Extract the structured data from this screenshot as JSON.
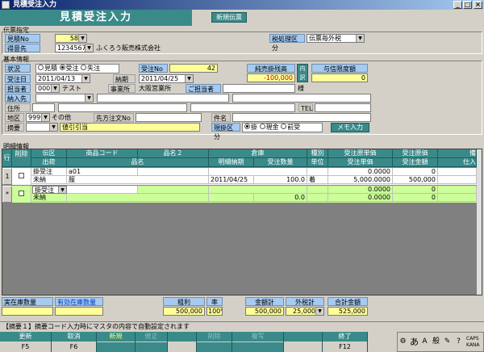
{
  "window": {
    "title": "見積受注入力"
  },
  "banner": {
    "title": "見積受注入力",
    "mode_badge": "新規伝票"
  },
  "denpyo": {
    "section": "伝票指定",
    "mitsumori_no_label": "見積No",
    "mitsumori_no_value": "58",
    "tokuisaki_label": "得意先",
    "tokuisaki_code": "1234567",
    "tokuisaki_name": "ふくろう販売株式会社",
    "zei_label": "税処理区分",
    "zei_value": "伝票毎外税"
  },
  "kihon": {
    "section": "基本情報",
    "jokyo_label": "状況",
    "jokyo_options": [
      "見積",
      "受注",
      "失注"
    ],
    "jokyo_selected": 1,
    "juchu_no_label": "受注No",
    "juchu_no_value": "42",
    "juchu_date_label": "受注日",
    "juchu_date_value": "2011/04/13",
    "noki_label": "納期",
    "noki_value": "2011/04/25",
    "tanto_label": "担当者",
    "tanto_code": "0001",
    "tanto_name": "テスト",
    "jigyosho_label": "事業所",
    "jigyosho_value": "大阪営業所",
    "gotanto_label": "ご担当者名",
    "gotanto_suffix": "様",
    "nonyu_label": "納入先",
    "jusho_label": "住所",
    "tel_label": "TEL",
    "chiku_label": "地区",
    "chiku_code": "9999",
    "chiku_name": "その他",
    "sakichumon_label": "先方注文No",
    "kenmei_label": "件名",
    "tekiyo_label": "摘要",
    "tekiyo_value": "値引引当",
    "genkake_label": "現掛区分",
    "genkake_options": [
      "掛",
      "現金",
      "前受"
    ],
    "genkake_selected": 0,
    "memo_button": "メモ入力",
    "junshiri_label": "純売掛残高",
    "junshiri_value": "-100,000",
    "naiyaku_button": "内訳",
    "yoshin_label": "与信限度額",
    "yoshin_value": "0"
  },
  "meisai": {
    "section": "明細情報",
    "headers_row1": [
      "行No",
      "削除",
      "伝区",
      "商品コード",
      "品名２",
      "倉庫",
      "",
      "種別",
      "受注原単価",
      "受注原価",
      "備"
    ],
    "headers_row2": [
      "",
      "",
      "出荷",
      "品名",
      "",
      "明細納期",
      "受注数量",
      "単位",
      "受注単価",
      "受注金額",
      "仕入"
    ],
    "rows": [
      {
        "no": "1",
        "denku": "掛受注",
        "shoka": "未納",
        "code": "a01",
        "name": "服",
        "noki": "2011/04/25",
        "qty": "100.0",
        "unit": "着",
        "gen_tanka": "0.0000",
        "gen_kin": "0",
        "tanka": "5,000.0000",
        "kingaku": "500,000"
      },
      {
        "no": "*",
        "denku": "掛受注",
        "shoka": "未納",
        "code": "",
        "name": "",
        "noki": "",
        "qty": "0.0",
        "unit": "",
        "gen_tanka": "0.0000",
        "gen_kin": "0",
        "tanka": "0.0000",
        "kingaku": "0"
      }
    ]
  },
  "summary": {
    "jitsuzaiko_label": "実在庫数量",
    "yuko_label": "有効在庫数量",
    "arari_label": "粗利",
    "arari_value": "500,000",
    "ritsu_label": "率",
    "ritsu_value": "100%",
    "kingaku_label": "金額計",
    "kingaku_value": "500,000",
    "sotozei_label": "外税計",
    "sotozei_value": "25,000",
    "gokei_label": "合計金額",
    "gokei_value": "525,000"
  },
  "message": "【摘要１】摘要コード入力時にマスタの内容で自動設定されます",
  "fkeys": [
    {
      "label": "更新",
      "key": "F5"
    },
    {
      "label": "取消",
      "key": "F6"
    },
    {
      "label": "新規",
      "key": ""
    },
    {
      "label": "修正",
      "key": ""
    },
    {
      "label": "削除",
      "key": ""
    },
    {
      "label": "複写",
      "key": ""
    },
    {
      "label": "終了",
      "key": "F12"
    }
  ],
  "tray": {
    "ime": "あ",
    "mode": "般"
  }
}
